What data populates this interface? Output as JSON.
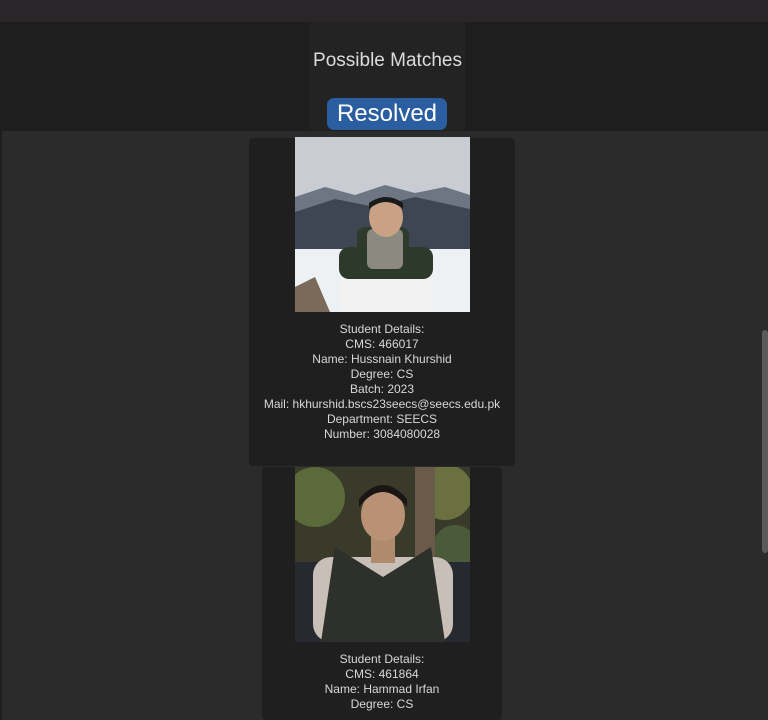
{
  "header": {
    "title": "Possible Matches",
    "resolved_label": "Resolved"
  },
  "colors": {
    "resolved_button": "#2b5ea0",
    "background": "#1e1e1e",
    "panel": "#2b2b2b",
    "card": "#1f1f1f"
  },
  "students": [
    {
      "heading": "Student Details:",
      "cms": "CMS: 466017",
      "name": "Name: Hussnain Khurshid",
      "degree": "Degree: CS",
      "batch": "Batch: 2023",
      "mail": "Mail: hkhurshid.bscs23seecs@seecs.edu.pk",
      "department": "Department: SEECS",
      "number": "Number: 3084080028"
    },
    {
      "heading": "Student Details:",
      "cms": "CMS: 461864",
      "name": "Name: Hammad Irfan",
      "degree": "Degree: CS"
    }
  ]
}
